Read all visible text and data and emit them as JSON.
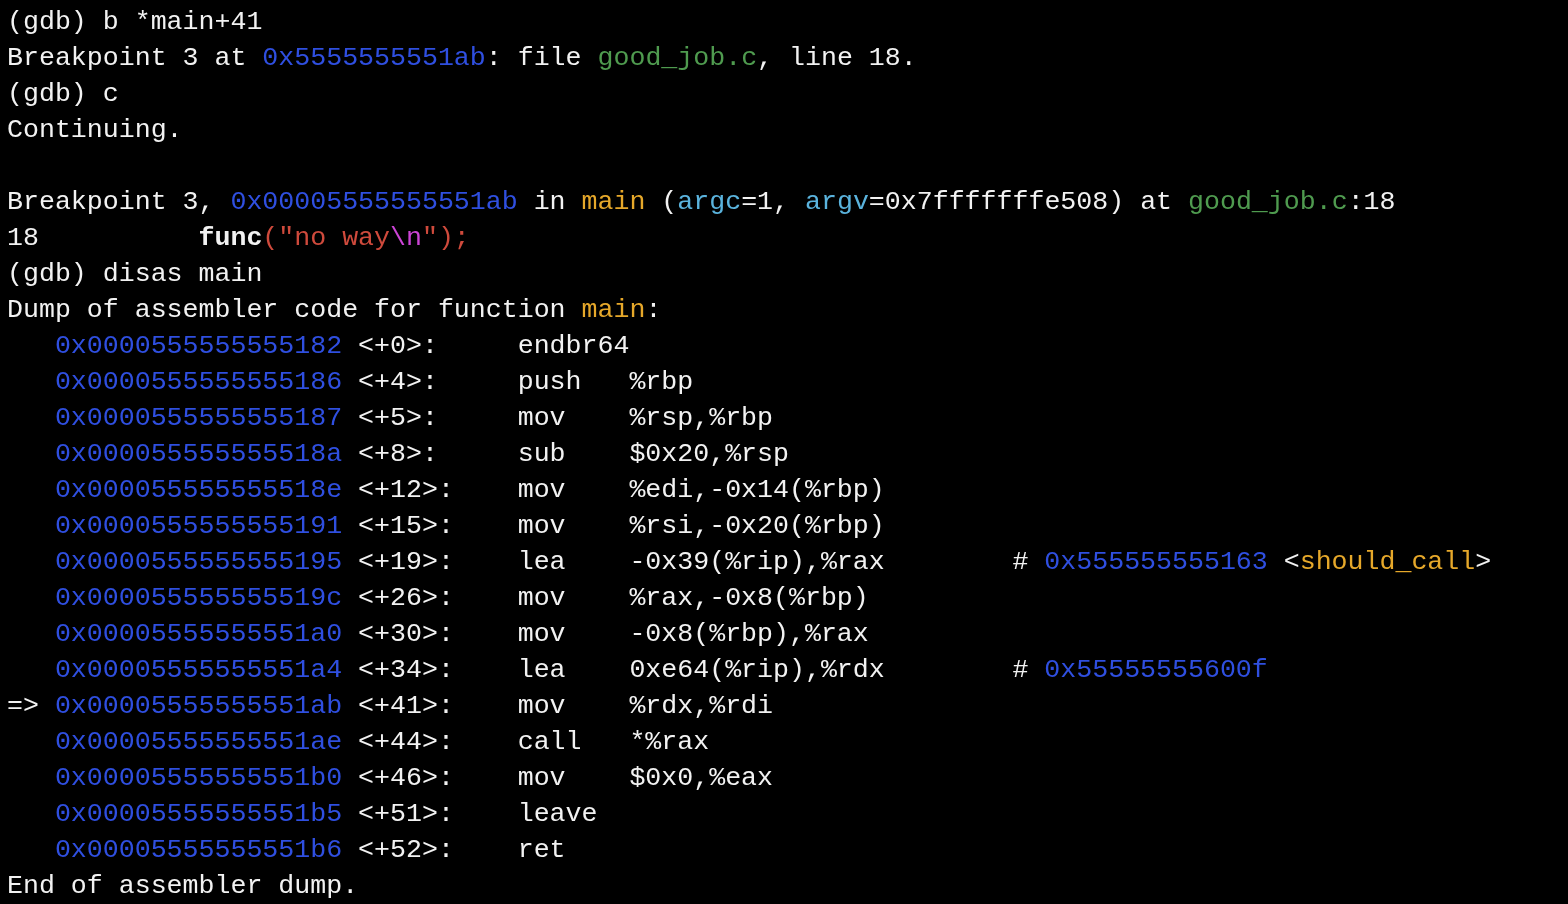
{
  "terminal": {
    "lines": [
      {
        "kind": "text",
        "segments": [
          {
            "t": "(gdb) b *main+41",
            "kind": "plain"
          }
        ]
      },
      {
        "kind": "text",
        "segments": [
          {
            "t": "Breakpoint 3 at ",
            "kind": "plain"
          },
          {
            "t": "0x5555555551ab",
            "kind": "addr"
          },
          {
            "t": ": file ",
            "kind": "plain"
          },
          {
            "t": "good_job.c",
            "kind": "file"
          },
          {
            "t": ", line 18.",
            "kind": "plain"
          }
        ]
      },
      {
        "kind": "text",
        "segments": [
          {
            "t": "(gdb) c",
            "kind": "plain"
          }
        ]
      },
      {
        "kind": "text",
        "segments": [
          {
            "t": "Continuing.",
            "kind": "plain"
          }
        ]
      },
      {
        "kind": "blank"
      },
      {
        "kind": "text",
        "segments": [
          {
            "t": "Breakpoint 3, ",
            "kind": "plain"
          },
          {
            "t": "0x00005555555551ab",
            "kind": "addr"
          },
          {
            "t": " in ",
            "kind": "plain"
          },
          {
            "t": "main",
            "kind": "fn"
          },
          {
            "t": " (",
            "kind": "plain"
          },
          {
            "t": "argc",
            "kind": "var"
          },
          {
            "t": "=1, ",
            "kind": "plain"
          },
          {
            "t": "argv",
            "kind": "var"
          },
          {
            "t": "=0x7fffffffe508) at ",
            "kind": "plain"
          },
          {
            "t": "good_job.c",
            "kind": "file"
          },
          {
            "t": ":18",
            "kind": "plain"
          }
        ]
      },
      {
        "kind": "text",
        "segments": [
          {
            "t": "18          ",
            "kind": "plain"
          },
          {
            "t": "func",
            "kind": "bold"
          },
          {
            "t": "(\"no way",
            "kind": "str"
          },
          {
            "t": "\\n",
            "kind": "esc"
          },
          {
            "t": "\");",
            "kind": "str"
          }
        ]
      },
      {
        "kind": "text",
        "segments": [
          {
            "t": "(gdb) disas main",
            "kind": "plain"
          }
        ]
      },
      {
        "kind": "text",
        "segments": [
          {
            "t": "Dump of assembler code for function ",
            "kind": "plain"
          },
          {
            "t": "main",
            "kind": "fn"
          },
          {
            "t": ":",
            "kind": "plain"
          }
        ]
      },
      {
        "kind": "asm",
        "segments": [
          {
            "t": "0x0000555555555182",
            "kind": "addr"
          },
          {
            "t": " <+0>:     endbr64",
            "kind": "plain"
          }
        ]
      },
      {
        "kind": "asm",
        "segments": [
          {
            "t": "0x0000555555555186",
            "kind": "addr"
          },
          {
            "t": " <+4>:     push   %rbp",
            "kind": "plain"
          }
        ]
      },
      {
        "kind": "asm",
        "segments": [
          {
            "t": "0x0000555555555187",
            "kind": "addr"
          },
          {
            "t": " <+5>:     mov    %rsp,%rbp",
            "kind": "plain"
          }
        ]
      },
      {
        "kind": "asm",
        "segments": [
          {
            "t": "0x000055555555518a",
            "kind": "addr"
          },
          {
            "t": " <+8>:     sub    $0x20,%rsp",
            "kind": "plain"
          }
        ]
      },
      {
        "kind": "asm",
        "segments": [
          {
            "t": "0x000055555555518e",
            "kind": "addr"
          },
          {
            "t": " <+12>:    mov    %edi,-0x14(%rbp)",
            "kind": "plain"
          }
        ]
      },
      {
        "kind": "asm",
        "segments": [
          {
            "t": "0x0000555555555191",
            "kind": "addr"
          },
          {
            "t": " <+15>:    mov    %rsi,-0x20(%rbp)",
            "kind": "plain"
          }
        ]
      },
      {
        "kind": "asm",
        "segments": [
          {
            "t": "0x0000555555555195",
            "kind": "addr"
          },
          {
            "t": " <+19>:    lea    -0x39(%rip),%rax        # ",
            "kind": "plain"
          },
          {
            "t": "0x555555555163",
            "kind": "addr"
          },
          {
            "t": " <",
            "kind": "plain"
          },
          {
            "t": "should_call",
            "kind": "fn"
          },
          {
            "t": ">",
            "kind": "plain"
          }
        ]
      },
      {
        "kind": "asm",
        "segments": [
          {
            "t": "0x000055555555519c",
            "kind": "addr"
          },
          {
            "t": " <+26>:    mov    %rax,-0x8(%rbp)",
            "kind": "plain"
          }
        ]
      },
      {
        "kind": "asm",
        "segments": [
          {
            "t": "0x00005555555551a0",
            "kind": "addr"
          },
          {
            "t": " <+30>:    mov    -0x8(%rbp),%rax",
            "kind": "plain"
          }
        ]
      },
      {
        "kind": "asm",
        "segments": [
          {
            "t": "0x00005555555551a4",
            "kind": "addr"
          },
          {
            "t": " <+34>:    lea    0xe64(%rip),%rdx        # ",
            "kind": "plain"
          },
          {
            "t": "0x55555555600f",
            "kind": "addr"
          }
        ]
      },
      {
        "kind": "asm",
        "marker": "=>",
        "segments": [
          {
            "t": "0x00005555555551ab",
            "kind": "addr"
          },
          {
            "t": " <+41>:    mov    %rdx,%rdi",
            "kind": "plain"
          }
        ]
      },
      {
        "kind": "asm",
        "segments": [
          {
            "t": "0x00005555555551ae",
            "kind": "addr"
          },
          {
            "t": " <+44>:    call   *%rax",
            "kind": "plain"
          }
        ]
      },
      {
        "kind": "asm",
        "segments": [
          {
            "t": "0x00005555555551b0",
            "kind": "addr"
          },
          {
            "t": " <+46>:    mov    $0x0,%eax",
            "kind": "plain"
          }
        ]
      },
      {
        "kind": "asm",
        "segments": [
          {
            "t": "0x00005555555551b5",
            "kind": "addr"
          },
          {
            "t": " <+51>:    leave",
            "kind": "plain"
          }
        ]
      },
      {
        "kind": "asm",
        "segments": [
          {
            "t": "0x00005555555551b6",
            "kind": "addr"
          },
          {
            "t": " <+52>:    ret",
            "kind": "plain"
          }
        ]
      },
      {
        "kind": "text",
        "segments": [
          {
            "t": "End of assembler dump.",
            "kind": "plain"
          }
        ]
      }
    ]
  }
}
